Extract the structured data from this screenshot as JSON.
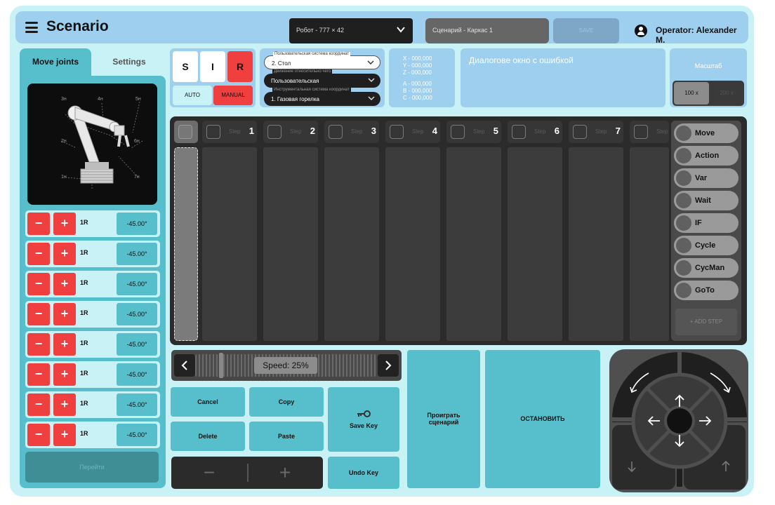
{
  "header": {
    "title": "Scenario",
    "robot_select": "Робот - 777 × 42",
    "scenario_select": "Сценарий - Каркас 1",
    "save_label": "SAVE",
    "operator": "Operator: Alexander M."
  },
  "left": {
    "tabs": [
      {
        "label": "Move joints"
      },
      {
        "label": "Settings"
      }
    ],
    "robot_labels": [
      "3н",
      "4н",
      "5н",
      "2н",
      "6н",
      "1н",
      "7н"
    ],
    "joints": [
      {
        "minus": "−",
        "plus": "+",
        "label": "1R",
        "value": "-45.00°"
      },
      {
        "minus": "−",
        "plus": "+",
        "label": "1R",
        "value": "-45.00°"
      },
      {
        "minus": "−",
        "plus": "+",
        "label": "1R",
        "value": "-45.00°"
      },
      {
        "minus": "−",
        "plus": "+",
        "label": "1R",
        "value": "-45.00°"
      },
      {
        "minus": "−",
        "plus": "+",
        "label": "1R",
        "value": "-45.00°"
      },
      {
        "minus": "−",
        "plus": "+",
        "label": "1R",
        "value": "-45.00°"
      },
      {
        "minus": "−",
        "plus": "+",
        "label": "1R",
        "value": "-45.00°"
      },
      {
        "minus": "−",
        "plus": "+",
        "label": "1R",
        "value": "-45.00°"
      }
    ],
    "goto_label": "Перейти"
  },
  "mode": {
    "s": "S",
    "i": "I",
    "r": "R",
    "auto": "AUTO",
    "manual": "MANUAL",
    "active_color": "#ef3f3f"
  },
  "coords": {
    "user_cs_label": "Пользовательская система координат",
    "user_cs_value": "2. Стол",
    "relative_label": "Движение относительно чего",
    "relative_value": "Пользовательская",
    "tool_cs_label": "Инструментальная система координат",
    "tool_cs_value": "1. Газовая горелка"
  },
  "position": {
    "x": "X - 000,000",
    "y": "Y - 000,000",
    "z": "Z - 000,000",
    "a": "A - 000,000",
    "b": "B - 000,000",
    "c": "C - 000,000"
  },
  "error_text": "Диалогове окно с ошибкой",
  "scale": {
    "title": "Масштаб",
    "opt1": "100 x",
    "opt2": "200 x"
  },
  "steps": [
    {
      "label": "Step",
      "num": "1"
    },
    {
      "label": "Step",
      "num": "2"
    },
    {
      "label": "Step",
      "num": "3"
    },
    {
      "label": "Step",
      "num": "4"
    },
    {
      "label": "Step",
      "num": "5"
    },
    {
      "label": "Step",
      "num": "6"
    },
    {
      "label": "Step",
      "num": "7"
    },
    {
      "label": "Step",
      "num": ""
    }
  ],
  "commands": [
    "Move",
    "Action",
    "Var",
    "Wait",
    "IF",
    "Cycle",
    "CycMan",
    "GoTo"
  ],
  "add_step_label": "+ ADD STEP",
  "speed": {
    "label": "Speed:  25%",
    "value_percent": 25
  },
  "actions": {
    "cancel": "Cancel",
    "copy": "Copy",
    "delete": "Delete",
    "paste": "Paste",
    "save_key": "Save Key",
    "undo_key": "Undo Key",
    "play": "Проиграть сценарий",
    "stop": "ОСТАНОВИТЬ",
    "minus": "−",
    "plus": "+"
  },
  "joystick": {
    "icons": [
      "rotate-ccw-icon",
      "rotate-cw-icon",
      "arrow-up-icon",
      "arrow-left-icon",
      "arrow-right-icon",
      "arrow-down-icon",
      "z-down-icon",
      "z-up-icon"
    ]
  }
}
